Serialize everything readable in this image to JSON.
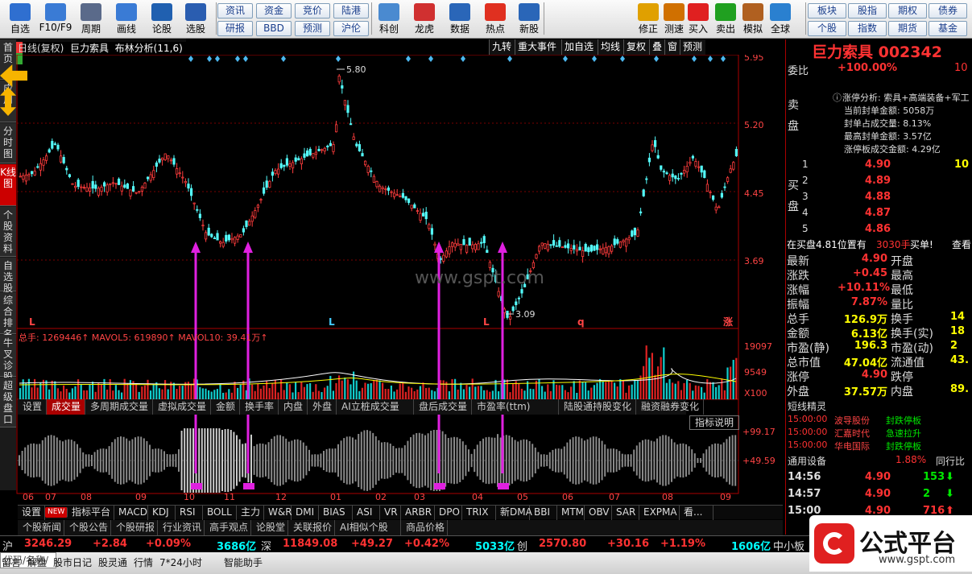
{
  "toolbar": {
    "items": [
      {
        "label": "自选",
        "icon": "star-icon"
      },
      {
        "label": "F10/F9",
        "icon": "document-icon"
      },
      {
        "label": "周期",
        "icon": "clock-icon"
      },
      {
        "label": "画线",
        "icon": "pencil-icon"
      },
      {
        "label": "论股",
        "icon": "discuss-icon"
      },
      {
        "label": "选股",
        "icon": "magnifier-icon"
      }
    ],
    "grid": [
      [
        "资讯",
        "资金",
        "竞价",
        "陆港"
      ],
      [
        "研报",
        "BBD",
        "预测",
        "沪伦"
      ]
    ],
    "items2": [
      {
        "label": "科创",
        "icon": "chart-icon"
      },
      {
        "label": "龙虎",
        "icon": "tiger-icon"
      },
      {
        "label": "数据",
        "icon": "pe-icon"
      },
      {
        "label": "热点",
        "icon": "hot-icon"
      },
      {
        "label": "新股",
        "icon": "ipo-icon"
      }
    ],
    "items3": [
      {
        "label": "修正",
        "icon": "smile-icon"
      },
      {
        "label": "测速",
        "icon": "alarm-icon"
      },
      {
        "label": "买入",
        "icon": "buy-icon"
      },
      {
        "label": "卖出",
        "icon": "sell-icon"
      },
      {
        "label": "模拟",
        "icon": "hammer-icon"
      },
      {
        "label": "全球",
        "icon": "globe-icon"
      }
    ],
    "right_grid": [
      [
        "板块",
        "股指",
        "期权",
        "债券"
      ],
      [
        "个股",
        "指数",
        "期货",
        "基金"
      ]
    ]
  },
  "left_tabs": [
    "首页",
    "应用",
    "分时图",
    "K线图",
    "个股资料",
    "自选股",
    "综合排名",
    "牛叉诊股",
    "超级盘口"
  ],
  "chart": {
    "title": "日线(复权)",
    "stock_name": "巨力索具",
    "indicator": "布林分析(11,6)",
    "header_buttons": [
      "九转",
      "重大事件",
      "加自选",
      "均线",
      "复权",
      "叠",
      "窗",
      "预测"
    ],
    "price_ticks": [
      "5.95",
      "5.20",
      "4.45",
      "3.69"
    ],
    "high_label": "5.80",
    "low_label": "3.09",
    "markers": [
      "L",
      "L",
      "L",
      "q",
      "涨"
    ],
    "volume_line": "总手: 1269446↑  MAVOL5: 619890↑  MAVOL10: 39.41万↑",
    "volume_ticks": [
      "19097",
      "9549",
      "X100"
    ],
    "sub_tabs": [
      "设置",
      "成交量",
      "多周期成交量",
      "虚拟成交量",
      "金额",
      "换手率",
      "内盘",
      "外盘",
      "AI立桩成交量",
      "盘后成交量",
      "市盈率(ttm)",
      "陆股通持股变化",
      "融资融券变化"
    ],
    "indicator_explain": "指标说明",
    "osc_ticks": [
      "+99.17",
      "+49.59"
    ],
    "months": [
      "06",
      "07",
      "08",
      "09",
      "10",
      "11",
      "12",
      "01",
      "02",
      "03",
      "04",
      "05",
      "06",
      "07",
      "08",
      "09"
    ],
    "indicator_tabs": [
      "设置",
      "NEW",
      "指标平台",
      "MACD",
      "KDJ",
      "RSI",
      "BOLL",
      "主力",
      "W&R",
      "DMI",
      "BIAS",
      "ASI",
      "VR",
      "ARBR",
      "DPO",
      "TRIX",
      "新DMA",
      "BBI",
      "MTM",
      "OBV",
      "SAR",
      "EXPMA",
      "看..."
    ],
    "watermark": "www.gspt.com"
  },
  "news_tabs": [
    "个股新闻",
    "个股公告",
    "个股研报",
    "行业资讯",
    "高手观点",
    "论股堂",
    "关联报价",
    "AI相似个股",
    "商品价格"
  ],
  "right": {
    "name": "巨力索具",
    "code": "002342",
    "weibi_label": "委比",
    "weibi": "+100.00%",
    "weibi_r": "10",
    "sell_label": "卖盘",
    "buy_label": "买盘",
    "limit_info": [
      "涨停分析: 索具+高端装备+军工",
      "当前封单金额: 5058万",
      "封单占成交量: 8.13%",
      "最高封单金额: 3.57亿",
      "涨停板成交金额: 4.29亿"
    ],
    "buy": [
      {
        "n": "1",
        "p": "4.90",
        "v": "10"
      },
      {
        "n": "2",
        "p": "4.89",
        "v": ""
      },
      {
        "n": "3",
        "p": "4.88",
        "v": ""
      },
      {
        "n": "4",
        "p": "4.87",
        "v": ""
      },
      {
        "n": "5",
        "p": "4.86",
        "v": ""
      }
    ],
    "status": "在买盘4.81位置有",
    "status_amt": "3030手",
    "status_tail": "买单!",
    "status_link": "查看",
    "quote": [
      [
        "最新",
        "4.90",
        "开盘",
        ""
      ],
      [
        "涨跌",
        "+0.45",
        "最高",
        ""
      ],
      [
        "涨幅",
        "+10.11%",
        "最低",
        ""
      ],
      [
        "振幅",
        "7.87%",
        "量比",
        ""
      ],
      [
        "总手",
        "126.9万",
        "换手",
        "14"
      ],
      [
        "金额",
        "6.13亿",
        "换手(实)",
        "18"
      ],
      [
        "市盈(静)",
        "196.3",
        "市盈(动)",
        "2"
      ],
      [
        "总市值",
        "47.04亿",
        "流通值",
        "43."
      ],
      [
        "涨停",
        "4.90",
        "跌停",
        ""
      ],
      [
        "外盘",
        "37.57万",
        "内盘",
        "89."
      ]
    ],
    "short_title": "短线精灵",
    "short": [
      [
        "15:00:00",
        "波导股份",
        "封跌停板"
      ],
      [
        "15:00:00",
        "汇嘉时代",
        "急速拉升"
      ],
      [
        "15:00:00",
        "华电国际",
        "封跌停板"
      ]
    ],
    "sector": "通用设备",
    "sector_pct": "1.88%",
    "sector_tail": "同行比",
    "ticks": [
      [
        "14:56",
        "4.90",
        "153",
        "down"
      ],
      [
        "14:57",
        "4.90",
        "2",
        "down"
      ],
      [
        "15:00",
        "4.90",
        "716",
        "up"
      ]
    ]
  },
  "index_bar": [
    {
      "n": "沪",
      "v": "3246.29",
      "c": "+2.84",
      "p": "+0.09%",
      "a": "3686亿"
    },
    {
      "n": "深",
      "v": "11849.08",
      "c": "+49.27",
      "p": "+0.42%",
      "a": "5033亿"
    },
    {
      "n": "创",
      "v": "2570.80",
      "c": "+30.16",
      "p": "+1.19%",
      "a": "1606亿"
    }
  ],
  "index_tail": "中小板",
  "status_bar": [
    "留言",
    "解盘",
    "股市日记",
    "股灵通",
    "行情",
    "7*24小时",
    "智能助手"
  ],
  "code_input": "代码/名称/",
  "logo": {
    "text": "公式平台",
    "url": "www.gspt.com"
  }
}
